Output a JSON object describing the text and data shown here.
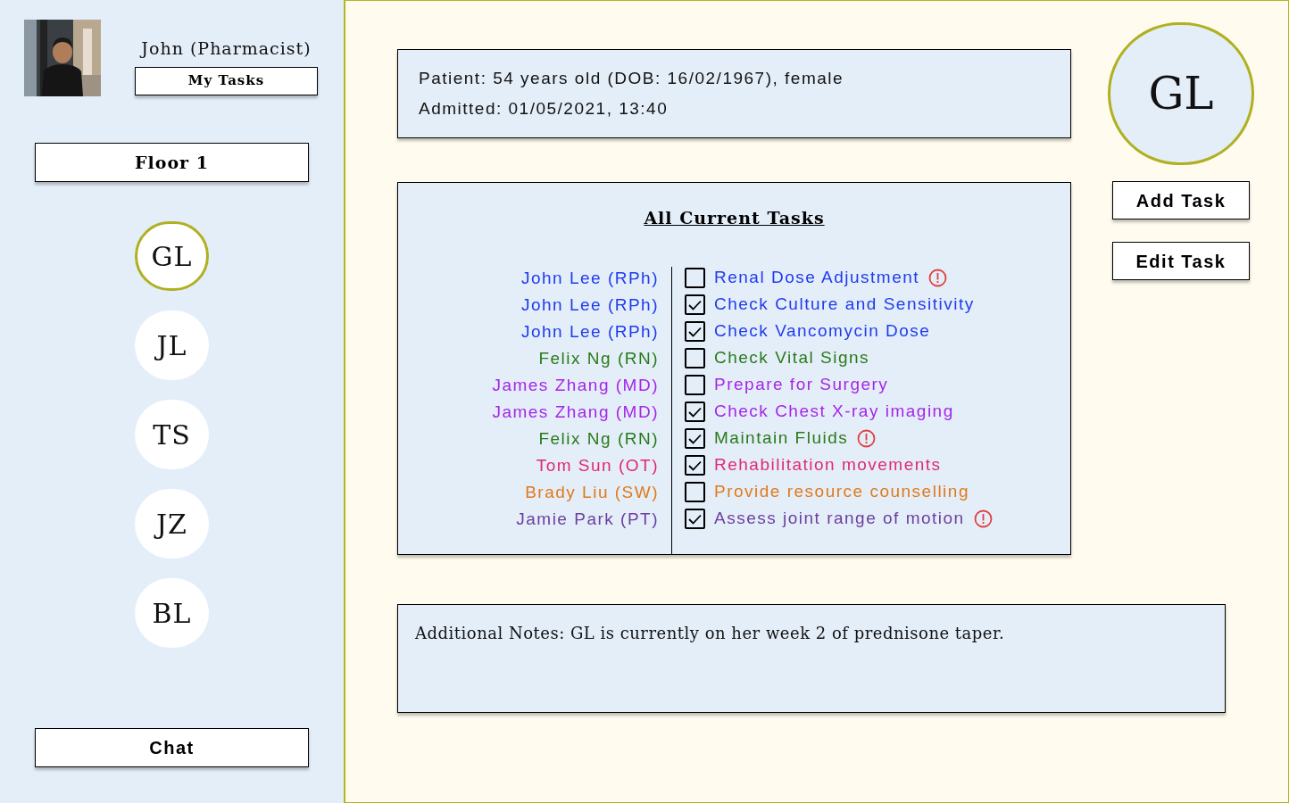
{
  "user": {
    "name": "John (Pharmacist)",
    "my_tasks_button": "My Tasks"
  },
  "floor_button": "Floor 1",
  "patients": [
    {
      "initials": "GL",
      "selected": true
    },
    {
      "initials": "JL",
      "selected": false
    },
    {
      "initials": "TS",
      "selected": false
    },
    {
      "initials": "JZ",
      "selected": false
    },
    {
      "initials": "BL",
      "selected": false
    }
  ],
  "chat_button": "Chat",
  "patient_info": [
    "Patient: 54 years old (DOB: 16/02/1967), female",
    "Admitted: 01/05/2021, 13:40"
  ],
  "patient_avatar": "GL",
  "actions": [
    "Add Task",
    "Edit Task"
  ],
  "tasks_panel": {
    "title": "All Current Tasks",
    "tasks": [
      {
        "assignee": "John Lee (RPh)",
        "task": "Renal Dose Adjustment",
        "checked": false,
        "alert": true,
        "color": "#1f3bef"
      },
      {
        "assignee": "John Lee (RPh)",
        "task": "Check Culture and Sensitivity",
        "checked": true,
        "alert": false,
        "color": "#1f3bef"
      },
      {
        "assignee": "John Lee (RPh)",
        "task": "Check Vancomycin Dose",
        "checked": true,
        "alert": false,
        "color": "#1f3bef"
      },
      {
        "assignee": "Felix Ng (RN)",
        "task": "Check Vital Signs",
        "checked": false,
        "alert": false,
        "color": "#2a7a1a"
      },
      {
        "assignee": "James Zhang (MD)",
        "task": "Prepare for Surgery",
        "checked": false,
        "alert": false,
        "color": "#a526e8"
      },
      {
        "assignee": "James Zhang (MD)",
        "task": "Check Chest X-ray imaging",
        "checked": true,
        "alert": false,
        "color": "#a526e8"
      },
      {
        "assignee": "Felix Ng (RN)",
        "task": "Maintain Fluids",
        "checked": true,
        "alert": true,
        "color": "#2a7a1a"
      },
      {
        "assignee": "Tom Sun (OT)",
        "task": "Rehabilitation movements",
        "checked": true,
        "alert": false,
        "color": "#e0287a"
      },
      {
        "assignee": "Brady Liu (SW)",
        "task": "Provide resource counselling",
        "checked": false,
        "alert": false,
        "color": "#e07a1a"
      },
      {
        "assignee": "Jamie Park (PT)",
        "task": "Assess joint range of motion",
        "checked": true,
        "alert": true,
        "color": "#6a3f9e"
      }
    ]
  },
  "notes": "Additional Notes: GL is currently on her week 2 of prednisone taper."
}
